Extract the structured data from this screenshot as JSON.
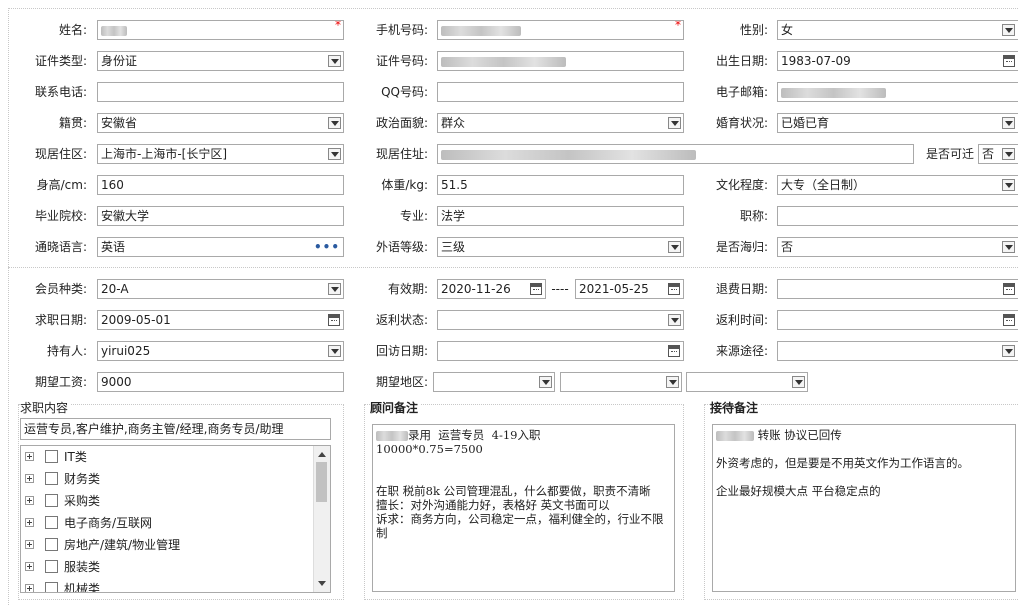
{
  "form": {
    "name_label": "姓名:",
    "mobile_label": "手机号码:",
    "gender_label": "性别:",
    "gender_value": "女",
    "id_type_label": "证件类型:",
    "id_type_value": "身份证",
    "id_no_label": "证件号码:",
    "birth_label": "出生日期:",
    "birth_value": "1983-07-09",
    "phone_label": "联系电话:",
    "qq_label": "QQ号码:",
    "email_label": "电子邮箱:",
    "native_label": "籍贯:",
    "native_value": "安徽省",
    "political_label": "政治面貌:",
    "political_value": "群众",
    "marital_label": "婚育状况:",
    "marital_value": "已婚已育",
    "area_label": "现居住区:",
    "area_value": "上海市-上海市-[长宁区]",
    "address_label": "现居住址:",
    "relocate_label": "是否可迁",
    "relocate_value": "否",
    "height_label": "身高/cm:",
    "height_value": "160",
    "weight_label": "体重/kg:",
    "weight_value": "51.5",
    "education_label": "文化程度:",
    "education_value": "大专（全日制）",
    "school_label": "毕业院校:",
    "school_value": "安徽大学",
    "major_label": "专业:",
    "major_value": "法学",
    "title_label": "职称:",
    "language_label": "通晓语言:",
    "language_value": "英语",
    "lang_level_label": "外语等级:",
    "lang_level_value": "三级",
    "returnee_label": "是否海归:",
    "returnee_value": "否",
    "required_mark": "*",
    "dots": "•••"
  },
  "member": {
    "type_label": "会员种类:",
    "type_value": "20-A",
    "valid_label": "有效期:",
    "valid_from": "2020-11-26",
    "valid_sep": "----",
    "valid_to": "2021-05-25",
    "refund_label": "退费日期:",
    "job_date_label": "求职日期:",
    "job_date_value": "2009-05-01",
    "rebate_status_label": "返利状态:",
    "rebate_time_label": "返利时间:",
    "holder_label": "持有人:",
    "holder_value": "yirui025",
    "visit_label": "回访日期:",
    "source_label": "来源途径:",
    "salary_label": "期望工资:",
    "salary_value": "9000",
    "region_label": "期望地区:"
  },
  "job_content": {
    "title": "求职内容",
    "summary": "运营专员,客户维护,商务主管/经理,商务专员/助理",
    "categories": [
      "IT类",
      "财务类",
      "采购类",
      "电子商务/互联网",
      "房地产/建筑/物业管理",
      "服装类",
      "机械类"
    ]
  },
  "consultant": {
    "title": "顾问备注",
    "line1": "录用  运营专员  4-19入职",
    "text": "10000*0.75=7500\n\n\n在职 税前8k 公司管理混乱，什么都要做，职责不清晰\n擅长：对外沟通能力好，表格好 英文书面可以\n诉求：商务方向，公司稳定一点，福利健全的，行业不限制"
  },
  "reception": {
    "title": "接待备注",
    "line1": "转账 协议已回传",
    "text": "\n外资考虑的，但是要是不用英文作为工作语言的。\n\n企业最好规模大点 平台稳定点的"
  }
}
